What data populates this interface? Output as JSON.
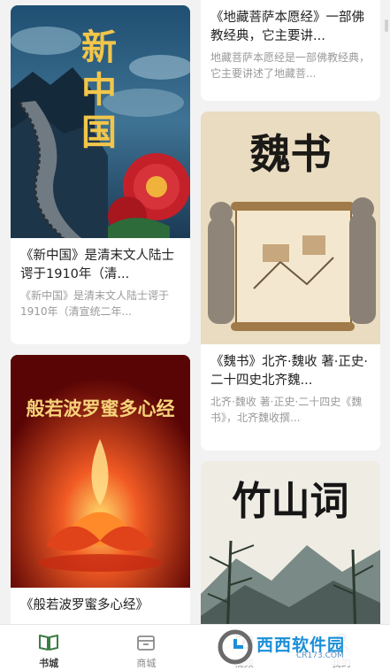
{
  "books_left": [
    {
      "cover_title": "新中国",
      "title": "《新中国》是清末文人陆士谔于1910年（清...",
      "desc": "《新中国》是清末文人陆士谔于1910年（清宣统二年..."
    },
    {
      "cover_title": "般若波罗蜜多心经",
      "title": "《般若波罗蜜多心经》"
    }
  ],
  "books_right": [
    {
      "title": "《地藏菩萨本愿经》一部佛教经典，它主要讲...",
      "desc": "地藏菩萨本愿经是一部佛教经典，它主要讲述了地藏菩..."
    },
    {
      "cover_title": "魏书",
      "title": "《魏书》北齐·魏收 著·正史·二十四史北齐魏...",
      "desc": "北齐·魏收 著·正史·二十四史《魏书》，北齐魏收撰..."
    },
    {
      "cover_title": "竹山词"
    }
  ],
  "tabbar": {
    "tabs": [
      {
        "label": "书城",
        "icon": "book-open-icon",
        "active": true
      },
      {
        "label": "商城",
        "icon": "store-icon",
        "active": false
      },
      {
        "label": "视频",
        "icon": "video-icon",
        "active": false
      },
      {
        "label": "我的",
        "icon": "user-icon",
        "active": false
      }
    ]
  },
  "watermark": {
    "text": "西西软件园",
    "sub": "CR173.COM"
  },
  "colors": {
    "accent": "#3a7d44",
    "background": "#f2f2f2"
  }
}
